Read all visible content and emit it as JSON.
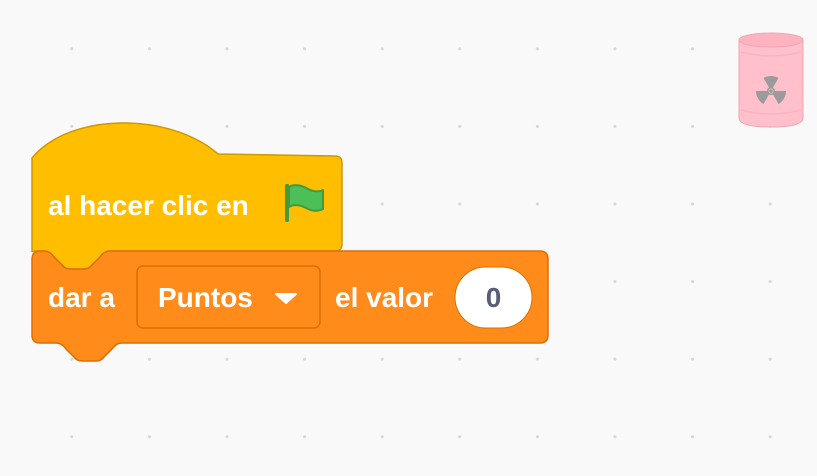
{
  "workspace": {
    "hat_block": {
      "label": "al hacer clic en",
      "icon": "green-flag-icon",
      "color": "#ffbf00"
    },
    "set_block": {
      "label_prefix": "dar a",
      "variable": "Puntos",
      "label_suffix": "el valor",
      "value": "0",
      "color": "#ff8c1a"
    },
    "trash": {
      "icon": "trash-can-icon"
    }
  }
}
